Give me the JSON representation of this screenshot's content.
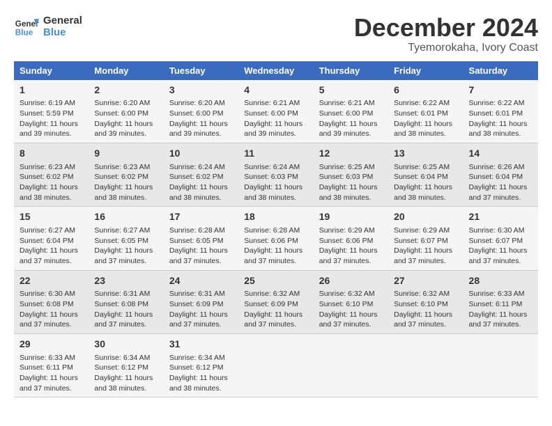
{
  "header": {
    "logo_line1": "General",
    "logo_line2": "Blue",
    "month": "December 2024",
    "location": "Tyemorokaha, Ivory Coast"
  },
  "days_of_week": [
    "Sunday",
    "Monday",
    "Tuesday",
    "Wednesday",
    "Thursday",
    "Friday",
    "Saturday"
  ],
  "weeks": [
    [
      {
        "day": "1",
        "sunrise": "6:19 AM",
        "sunset": "5:59 PM",
        "daylight": "11 hours and 39 minutes."
      },
      {
        "day": "2",
        "sunrise": "6:20 AM",
        "sunset": "6:00 PM",
        "daylight": "11 hours and 39 minutes."
      },
      {
        "day": "3",
        "sunrise": "6:20 AM",
        "sunset": "6:00 PM",
        "daylight": "11 hours and 39 minutes."
      },
      {
        "day": "4",
        "sunrise": "6:21 AM",
        "sunset": "6:00 PM",
        "daylight": "11 hours and 39 minutes."
      },
      {
        "day": "5",
        "sunrise": "6:21 AM",
        "sunset": "6:00 PM",
        "daylight": "11 hours and 39 minutes."
      },
      {
        "day": "6",
        "sunrise": "6:22 AM",
        "sunset": "6:01 PM",
        "daylight": "11 hours and 38 minutes."
      },
      {
        "day": "7",
        "sunrise": "6:22 AM",
        "sunset": "6:01 PM",
        "daylight": "11 hours and 38 minutes."
      }
    ],
    [
      {
        "day": "8",
        "sunrise": "6:23 AM",
        "sunset": "6:02 PM",
        "daylight": "11 hours and 38 minutes."
      },
      {
        "day": "9",
        "sunrise": "6:23 AM",
        "sunset": "6:02 PM",
        "daylight": "11 hours and 38 minutes."
      },
      {
        "day": "10",
        "sunrise": "6:24 AM",
        "sunset": "6:02 PM",
        "daylight": "11 hours and 38 minutes."
      },
      {
        "day": "11",
        "sunrise": "6:24 AM",
        "sunset": "6:03 PM",
        "daylight": "11 hours and 38 minutes."
      },
      {
        "day": "12",
        "sunrise": "6:25 AM",
        "sunset": "6:03 PM",
        "daylight": "11 hours and 38 minutes."
      },
      {
        "day": "13",
        "sunrise": "6:25 AM",
        "sunset": "6:04 PM",
        "daylight": "11 hours and 38 minutes."
      },
      {
        "day": "14",
        "sunrise": "6:26 AM",
        "sunset": "6:04 PM",
        "daylight": "11 hours and 37 minutes."
      }
    ],
    [
      {
        "day": "15",
        "sunrise": "6:27 AM",
        "sunset": "6:04 PM",
        "daylight": "11 hours and 37 minutes."
      },
      {
        "day": "16",
        "sunrise": "6:27 AM",
        "sunset": "6:05 PM",
        "daylight": "11 hours and 37 minutes."
      },
      {
        "day": "17",
        "sunrise": "6:28 AM",
        "sunset": "6:05 PM",
        "daylight": "11 hours and 37 minutes."
      },
      {
        "day": "18",
        "sunrise": "6:28 AM",
        "sunset": "6:06 PM",
        "daylight": "11 hours and 37 minutes."
      },
      {
        "day": "19",
        "sunrise": "6:29 AM",
        "sunset": "6:06 PM",
        "daylight": "11 hours and 37 minutes."
      },
      {
        "day": "20",
        "sunrise": "6:29 AM",
        "sunset": "6:07 PM",
        "daylight": "11 hours and 37 minutes."
      },
      {
        "day": "21",
        "sunrise": "6:30 AM",
        "sunset": "6:07 PM",
        "daylight": "11 hours and 37 minutes."
      }
    ],
    [
      {
        "day": "22",
        "sunrise": "6:30 AM",
        "sunset": "6:08 PM",
        "daylight": "11 hours and 37 minutes."
      },
      {
        "day": "23",
        "sunrise": "6:31 AM",
        "sunset": "6:08 PM",
        "daylight": "11 hours and 37 minutes."
      },
      {
        "day": "24",
        "sunrise": "6:31 AM",
        "sunset": "6:09 PM",
        "daylight": "11 hours and 37 minutes."
      },
      {
        "day": "25",
        "sunrise": "6:32 AM",
        "sunset": "6:09 PM",
        "daylight": "11 hours and 37 minutes."
      },
      {
        "day": "26",
        "sunrise": "6:32 AM",
        "sunset": "6:10 PM",
        "daylight": "11 hours and 37 minutes."
      },
      {
        "day": "27",
        "sunrise": "6:32 AM",
        "sunset": "6:10 PM",
        "daylight": "11 hours and 37 minutes."
      },
      {
        "day": "28",
        "sunrise": "6:33 AM",
        "sunset": "6:11 PM",
        "daylight": "11 hours and 37 minutes."
      }
    ],
    [
      {
        "day": "29",
        "sunrise": "6:33 AM",
        "sunset": "6:11 PM",
        "daylight": "11 hours and 37 minutes."
      },
      {
        "day": "30",
        "sunrise": "6:34 AM",
        "sunset": "6:12 PM",
        "daylight": "11 hours and 38 minutes."
      },
      {
        "day": "31",
        "sunrise": "6:34 AM",
        "sunset": "6:12 PM",
        "daylight": "11 hours and 38 minutes."
      },
      null,
      null,
      null,
      null
    ]
  ]
}
